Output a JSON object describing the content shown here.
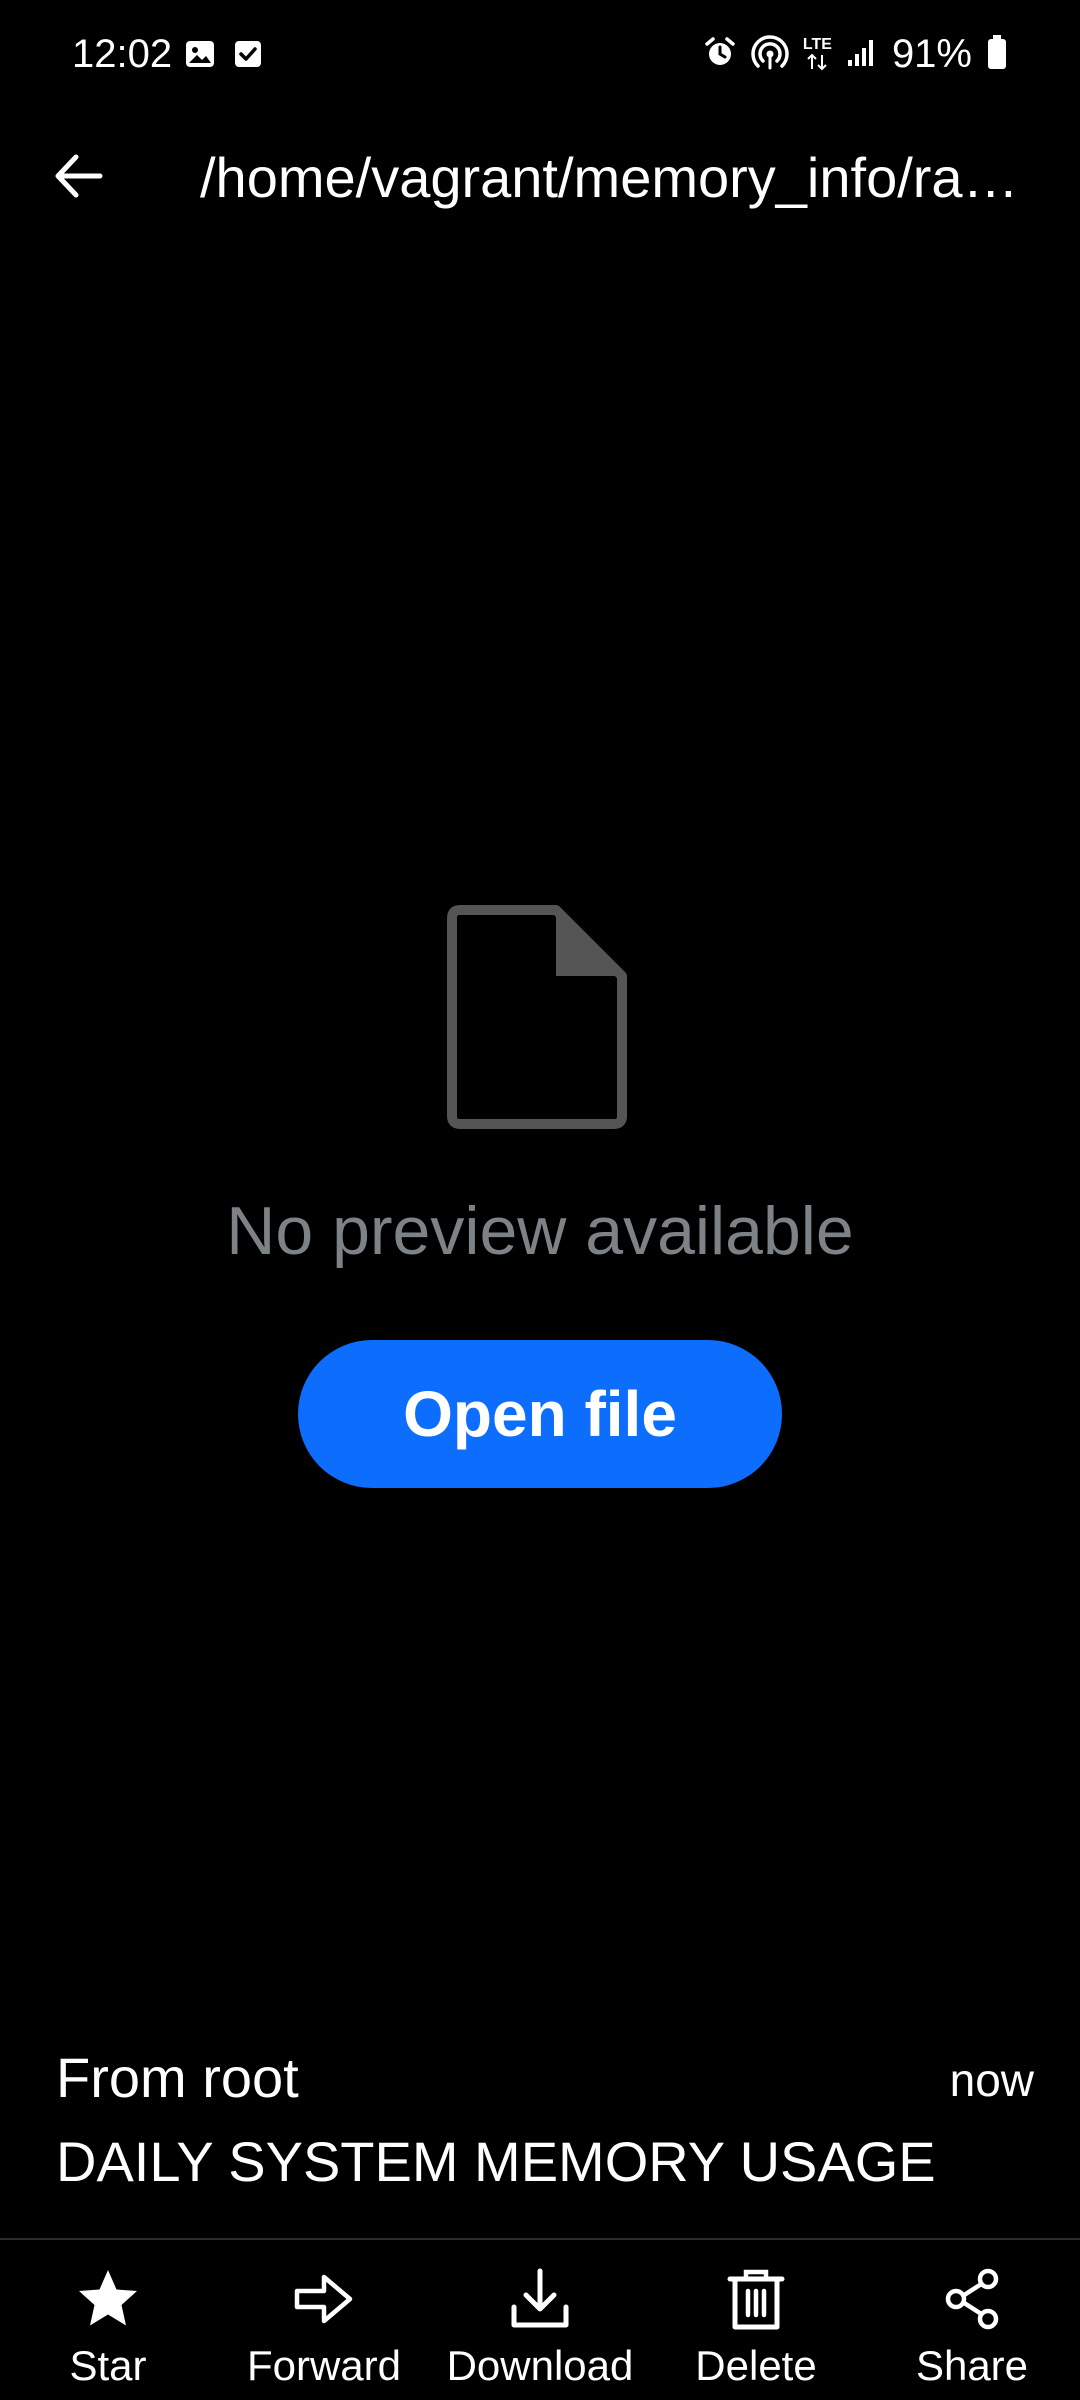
{
  "status_bar": {
    "time": "12:02",
    "battery_percent": "91%",
    "network": "LTE",
    "icons": [
      "gallery-icon",
      "checkbox-icon",
      "alarm-icon",
      "hotspot-icon",
      "lte-icon",
      "signal-icon",
      "battery-icon"
    ]
  },
  "app_bar": {
    "back_icon": "back-arrow-icon",
    "title": "/home/vagrant/memory_info/ram_usage"
  },
  "preview": {
    "icon": "document-icon",
    "message": "No preview available",
    "open_button_label": "Open file",
    "accent_color": "#0d6efd"
  },
  "message": {
    "from": "From root",
    "time": "now",
    "subject": "DAILY SYSTEM MEMORY USAGE"
  },
  "toolbar": {
    "items": [
      {
        "label": "Star",
        "icon": "star-icon"
      },
      {
        "label": "Forward",
        "icon": "forward-arrow-icon"
      },
      {
        "label": "Download",
        "icon": "download-icon"
      },
      {
        "label": "Delete",
        "icon": "trash-icon"
      },
      {
        "label": "Share",
        "icon": "share-icon"
      }
    ]
  }
}
